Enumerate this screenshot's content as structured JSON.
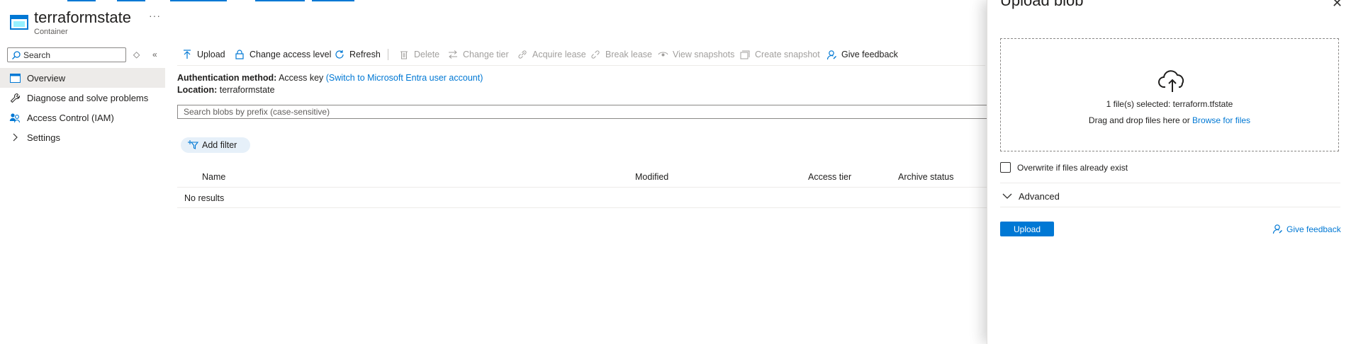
{
  "header": {
    "title": "terraformstate",
    "subtitle": "Container",
    "more": "···"
  },
  "nav": {
    "search_placeholder": "Search",
    "items": [
      {
        "label": "Overview",
        "icon": "container-icon",
        "active": true
      },
      {
        "label": "Diagnose and solve problems",
        "icon": "wrench-icon"
      },
      {
        "label": "Access Control (IAM)",
        "icon": "people-icon"
      },
      {
        "label": "Settings",
        "icon": "chevron-right-icon"
      }
    ]
  },
  "toolbar": {
    "upload": "Upload",
    "change_access": "Change access level",
    "refresh": "Refresh",
    "delete": "Delete",
    "change_tier": "Change tier",
    "acquire_lease": "Acquire lease",
    "break_lease": "Break lease",
    "view_snapshots": "View snapshots",
    "create_snapshot": "Create snapshot",
    "give_feedback": "Give feedback"
  },
  "main": {
    "auth_label": "Authentication method:",
    "auth_value": "Access key",
    "auth_link": "(Switch to Microsoft Entra user account)",
    "location_label": "Location:",
    "location_value": "terraformstate",
    "search_placeholder": "Search blobs by prefix (case-sensitive)",
    "add_filter": "Add filter",
    "columns": [
      "Name",
      "Modified",
      "Access tier",
      "Archive status"
    ],
    "empty": "No results"
  },
  "panel": {
    "title": "Upload blob",
    "selected": "1 file(s) selected: terraform.tfstate",
    "drag_text": "Drag and drop files here",
    "or": "or",
    "browse": "Browse for files",
    "overwrite": "Overwrite if files already exist",
    "advanced": "Advanced",
    "upload_button": "Upload",
    "feedback": "Give feedback"
  },
  "colors": {
    "accent": "#0078d4",
    "nav_active": "#edebe9",
    "filter_pill": "#e6f0f9"
  }
}
